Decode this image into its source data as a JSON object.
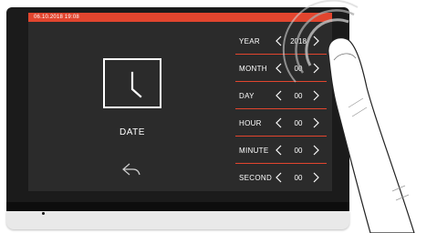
{
  "status_bar": {
    "datetime": "06.10.2018  19:08"
  },
  "screen": {
    "title": "DATE",
    "icons": {
      "main": "clock-icon",
      "back": "back-arrow-icon"
    }
  },
  "settings": [
    {
      "label": "YEAR",
      "value": "2018"
    },
    {
      "label": "MONTH",
      "value": "00"
    },
    {
      "label": "DAY",
      "value": "00"
    },
    {
      "label": "HOUR",
      "value": "00"
    },
    {
      "label": "MINUTE",
      "value": "00"
    },
    {
      "label": "SECOND",
      "value": "00"
    }
  ],
  "colors": {
    "accent": "#e2452e",
    "screen_bg": "#2b2b2b",
    "device_body": "#1b1b1b"
  }
}
